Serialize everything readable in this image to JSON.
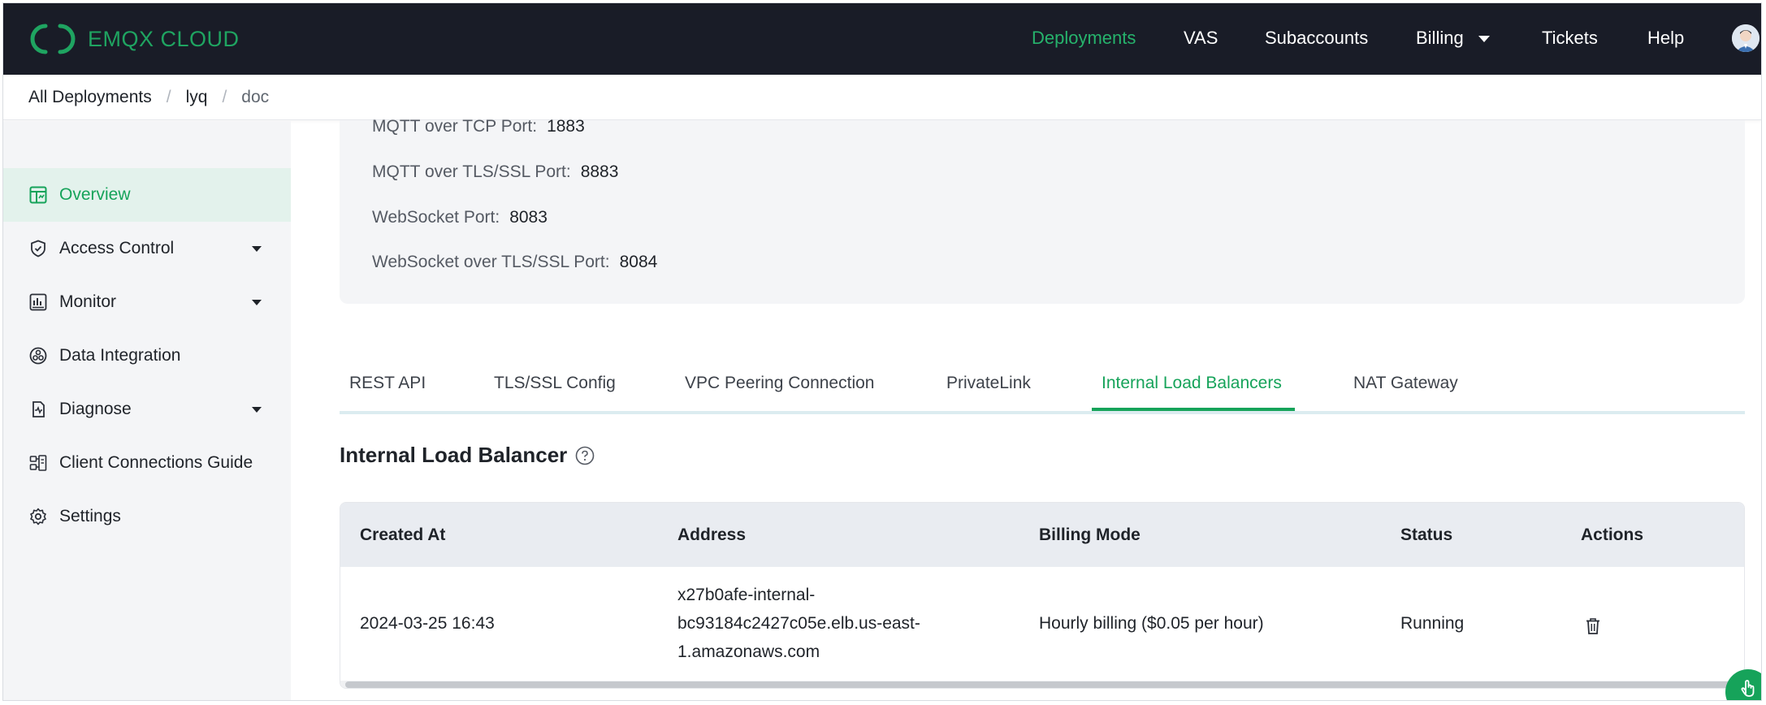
{
  "brand": {
    "name": "EMQX CLOUD",
    "color": "#1fa461"
  },
  "nav": {
    "items": [
      {
        "label": "Deployments",
        "active": true
      },
      {
        "label": "VAS"
      },
      {
        "label": "Subaccounts"
      },
      {
        "label": "Billing",
        "dropdown": true
      },
      {
        "label": "Tickets"
      },
      {
        "label": "Help"
      }
    ]
  },
  "breadcrumb": [
    "All Deployments",
    "lyq",
    "doc"
  ],
  "sidebar": {
    "items": [
      {
        "label": "Overview",
        "icon": "dashboard-icon",
        "active": true
      },
      {
        "label": "Access Control",
        "icon": "shield-icon",
        "expandable": true
      },
      {
        "label": "Monitor",
        "icon": "chart-icon",
        "expandable": true
      },
      {
        "label": "Data Integration",
        "icon": "integration-icon"
      },
      {
        "label": "Diagnose",
        "icon": "diagnose-icon",
        "expandable": true
      },
      {
        "label": "Client Connections Guide",
        "icon": "connections-icon"
      },
      {
        "label": "Settings",
        "icon": "gear-icon"
      }
    ]
  },
  "ports": [
    {
      "label": "MQTT over TCP Port:",
      "value": "1883"
    },
    {
      "label": "MQTT over TLS/SSL Port:",
      "value": "8883"
    },
    {
      "label": "WebSocket Port:",
      "value": "8083"
    },
    {
      "label": "WebSocket over TLS/SSL Port:",
      "value": "8084"
    }
  ],
  "tabs": [
    {
      "label": "REST API"
    },
    {
      "label": "TLS/SSL Config"
    },
    {
      "label": "VPC Peering Connection"
    },
    {
      "label": "PrivateLink"
    },
    {
      "label": "Internal Load Balancers",
      "active": true
    },
    {
      "label": "NAT Gateway"
    }
  ],
  "section": {
    "title": "Internal Load Balancer"
  },
  "table": {
    "columns": [
      "Created At",
      "Address",
      "Billing Mode",
      "Status",
      "Actions"
    ],
    "rows": [
      {
        "created_at": "2024-03-25 16:43",
        "address_lines": [
          "x27b0afe-internal-",
          "bc93184c2427c05e.elb.us-east-",
          "1.amazonaws.com"
        ],
        "billing_mode": "Hourly billing ($0.05 per hour)",
        "status": "Running",
        "action_icon": "trash-icon"
      }
    ]
  },
  "colors": {
    "accent": "#16a35a",
    "nav_bg": "#191c27"
  }
}
